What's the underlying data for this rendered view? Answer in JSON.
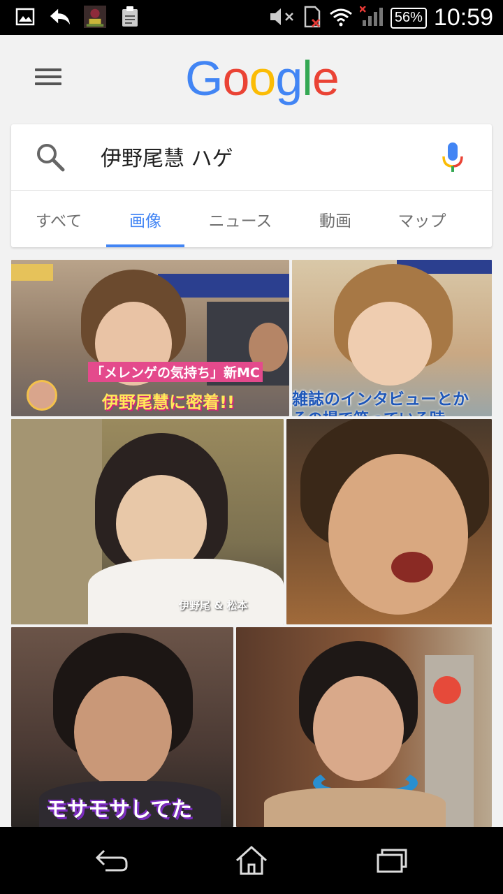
{
  "status_bar": {
    "battery": "56%",
    "time": "10:59",
    "icons": [
      "image-icon",
      "reply-icon",
      "game-app-icon",
      "clipboard-icon",
      "mute-icon",
      "sd-card-icon",
      "wifi-icon",
      "signal-icon"
    ]
  },
  "header": {
    "logo": [
      "G",
      "o",
      "o",
      "g",
      "l",
      "e"
    ],
    "logo_colors": [
      "#4285F4",
      "#EA4335",
      "#FBBC05",
      "#4285F4",
      "#34A853",
      "#EA4335"
    ]
  },
  "search": {
    "query": "伊野尾慧 ハゲ"
  },
  "tabs": [
    {
      "label": "すべて",
      "active": false
    },
    {
      "label": "画像",
      "active": true
    },
    {
      "label": "ニュース",
      "active": false
    },
    {
      "label": "動画",
      "active": false
    },
    {
      "label": "マップ",
      "active": false
    }
  ],
  "results": [
    {
      "captions": [
        "「メレンゲの気持ち」新MC",
        "伊野尾慧に密着!!"
      ]
    },
    {
      "captions": [
        "雑誌のインタビューとか",
        "その場で笑っている時"
      ]
    },
    {
      "captions": [
        "伊野尾 & 松本"
      ]
    },
    {
      "captions": []
    },
    {
      "captions": [
        "モサモサしてた"
      ]
    },
    {
      "captions": []
    }
  ],
  "colors": {
    "accent": "#4285f4",
    "tab_inactive": "#6f6f6f"
  }
}
